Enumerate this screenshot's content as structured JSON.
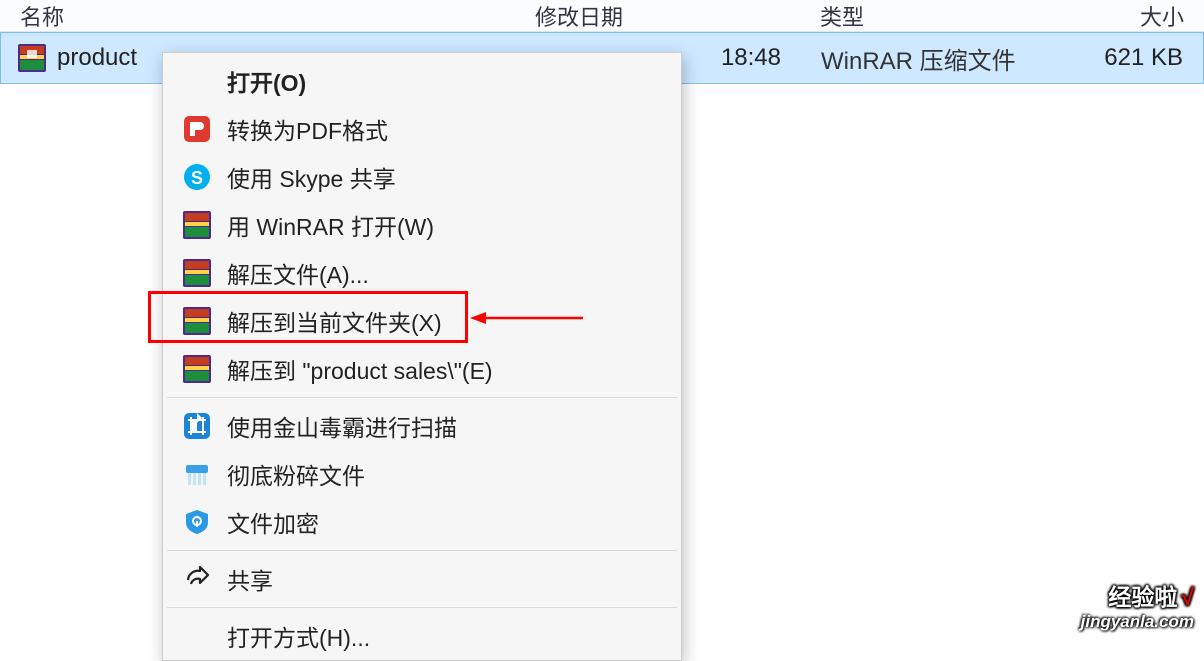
{
  "header": {
    "name": "名称",
    "date": "修改日期",
    "type": "类型",
    "size": "大小"
  },
  "file": {
    "name": "product",
    "time": "18:48",
    "type": "WinRAR 压缩文件",
    "size": "621 KB"
  },
  "menu": {
    "open": "打开(O)",
    "pdf": "转换为PDF格式",
    "skype": "使用 Skype 共享",
    "winrar": "用 WinRAR 打开(W)",
    "extractA": "解压文件(A)...",
    "extractX": "解压到当前文件夹(X)",
    "extractE": "解压到 \"product sales\\\"(E)",
    "scan": "使用金山毒霸进行扫描",
    "shred": "彻底粉碎文件",
    "encrypt": "文件加密",
    "share": "共享",
    "openwith": "打开方式(H)..."
  },
  "watermark": {
    "title": "经验啦",
    "check": "√",
    "url": "jingyanla.com"
  }
}
